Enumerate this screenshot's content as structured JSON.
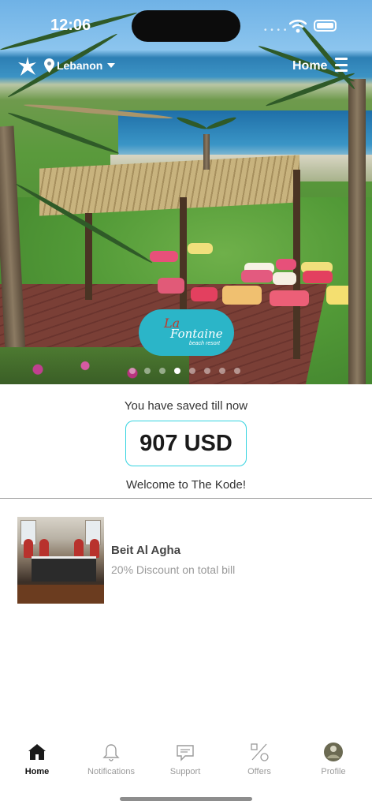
{
  "status_bar": {
    "time": "12:06"
  },
  "header": {
    "location": "Lebanon",
    "nav_title": "Home",
    "icons": [
      "brand-star-icon",
      "location-pin-icon",
      "chevron-down-icon",
      "menu-icon"
    ]
  },
  "banner": {
    "logo": {
      "line1": "La",
      "line2": "Fontaine",
      "line3": "beach resort"
    },
    "slide_count": 8,
    "active_slide": 4
  },
  "savings": {
    "title": "You have saved till now",
    "amount": "907 USD",
    "welcome": "Welcome to The Kode!",
    "accent_color": "#35d3e0"
  },
  "offers": [
    {
      "name": "Beit Al Agha",
      "description": "20% Discount on total bill"
    }
  ],
  "tabbar": {
    "tabs": [
      {
        "label": "Home",
        "icon": "home-icon",
        "active": true
      },
      {
        "label": "Notifications",
        "icon": "bell-icon",
        "active": false
      },
      {
        "label": "Support",
        "icon": "chat-icon",
        "active": false
      },
      {
        "label": "Offers",
        "icon": "percent-icon",
        "active": false
      },
      {
        "label": "Profile",
        "icon": "avatar-icon",
        "active": false
      }
    ]
  }
}
